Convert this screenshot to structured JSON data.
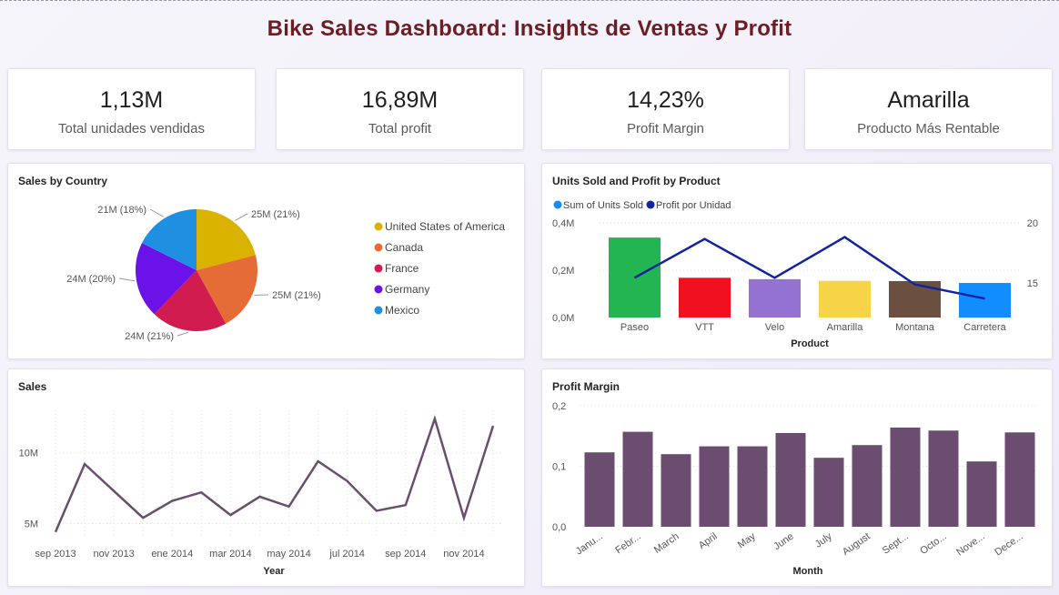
{
  "dashboard_title": "Bike Sales Dashboard: Insights de Ventas y Profit",
  "kpis": [
    {
      "value": "1,13M",
      "label": "Total unidades vendidas"
    },
    {
      "value": "16,89M",
      "label": "Total profit"
    },
    {
      "value": "14,23%",
      "label": "Profit Margin"
    },
    {
      "value": "Amarilla",
      "label": "Producto Más Rentable"
    }
  ],
  "sales_by_country": {
    "title": "Sales by Country",
    "legend": [
      "United States of America",
      "Canada",
      "France",
      "Germany",
      "Mexico"
    ],
    "slice_labels": [
      "25M (21%)",
      "25M (21%)",
      "24M (21%)",
      "24M (20%)",
      "21M (18%)"
    ]
  },
  "units_profit": {
    "title": "Units Sold and Profit by Product",
    "legend": [
      "Sum of Units Sold",
      "Profit por Unidad"
    ],
    "xlabel": "Product",
    "y_left_ticks": [
      "0,4M",
      "0,2M",
      "0,0M"
    ],
    "y_right_ticks": [
      "20",
      "15"
    ]
  },
  "sales": {
    "title": "Sales",
    "xlabel": "Year",
    "y_ticks": [
      "10M",
      "5M"
    ],
    "x_ticks": [
      "sep 2013",
      "nov 2013",
      "ene 2014",
      "mar 2014",
      "may 2014",
      "jul 2014",
      "sep 2014",
      "nov 2014"
    ]
  },
  "profit_margin": {
    "title": "Profit Margin",
    "xlabel": "Month",
    "y_ticks": [
      "0,2",
      "0,1",
      "0,0"
    ],
    "x_ticks": [
      "Janu...",
      "Febr...",
      "March",
      "April",
      "May",
      "June",
      "July",
      "August",
      "Sept...",
      "Octo...",
      "Nove...",
      "Dece..."
    ]
  },
  "colors": {
    "title": "#6b1f24",
    "purple_series": "#6b4d6f",
    "line_navy": "#12239e"
  },
  "chart_data": [
    {
      "type": "pie",
      "title": "Sales by Country",
      "categories": [
        "United States of America",
        "Canada",
        "France",
        "Germany",
        "Mexico"
      ],
      "values": [
        25,
        25,
        24,
        24,
        21
      ],
      "percent": [
        21,
        21,
        21,
        20,
        18
      ],
      "colors": [
        "#d9b300",
        "#e66c37",
        "#d11c4f",
        "#6b12e8",
        "#1e8fe1"
      ],
      "legend": "right"
    },
    {
      "type": "bar",
      "title": "Units Sold and Profit by Product",
      "categories": [
        "Paseo",
        "VTT",
        "Velo",
        "Amarilla",
        "Montana",
        "Carretera"
      ],
      "series": [
        {
          "name": "Sum of Units Sold",
          "type": "bar",
          "values": [
            338000,
            168000,
            162000,
            155000,
            154000,
            146000
          ]
        },
        {
          "name": "Profit por Unidad",
          "type": "line",
          "values": [
            14.2,
            18.3,
            14.2,
            18.5,
            13.5,
            12.0
          ]
        }
      ],
      "bar_colors": [
        "#22b552",
        "#f0101f",
        "#9372d1",
        "#f5d547",
        "#6b4f3f",
        "#118dff"
      ],
      "xlabel": "Product",
      "ylim_left": [
        0,
        400000
      ],
      "ylim_right": [
        10,
        20
      ],
      "legend": "top-left"
    },
    {
      "type": "line",
      "title": "Sales",
      "x": [
        "2013-09",
        "2013-10",
        "2013-11",
        "2013-12",
        "2014-01",
        "2014-02",
        "2014-03",
        "2014-04",
        "2014-05",
        "2014-06",
        "2014-07",
        "2014-08",
        "2014-09",
        "2014-10",
        "2014-11",
        "2014-12"
      ],
      "values": [
        4.4,
        9.2,
        7.3,
        5.4,
        6.6,
        7.2,
        5.6,
        6.9,
        6.2,
        9.4,
        8.0,
        5.9,
        6.3,
        12.4,
        5.4,
        11.9
      ],
      "unit": "M",
      "xlabel": "Year",
      "ylim": [
        4,
        13
      ],
      "grid": true
    },
    {
      "type": "bar",
      "title": "Profit Margin",
      "categories": [
        "January",
        "February",
        "March",
        "April",
        "May",
        "June",
        "July",
        "August",
        "September",
        "October",
        "November",
        "December"
      ],
      "values": [
        0.123,
        0.157,
        0.12,
        0.133,
        0.133,
        0.155,
        0.114,
        0.135,
        0.164,
        0.159,
        0.108,
        0.156
      ],
      "xlabel": "Month",
      "ylim": [
        0,
        0.2
      ],
      "grid": true
    }
  ]
}
